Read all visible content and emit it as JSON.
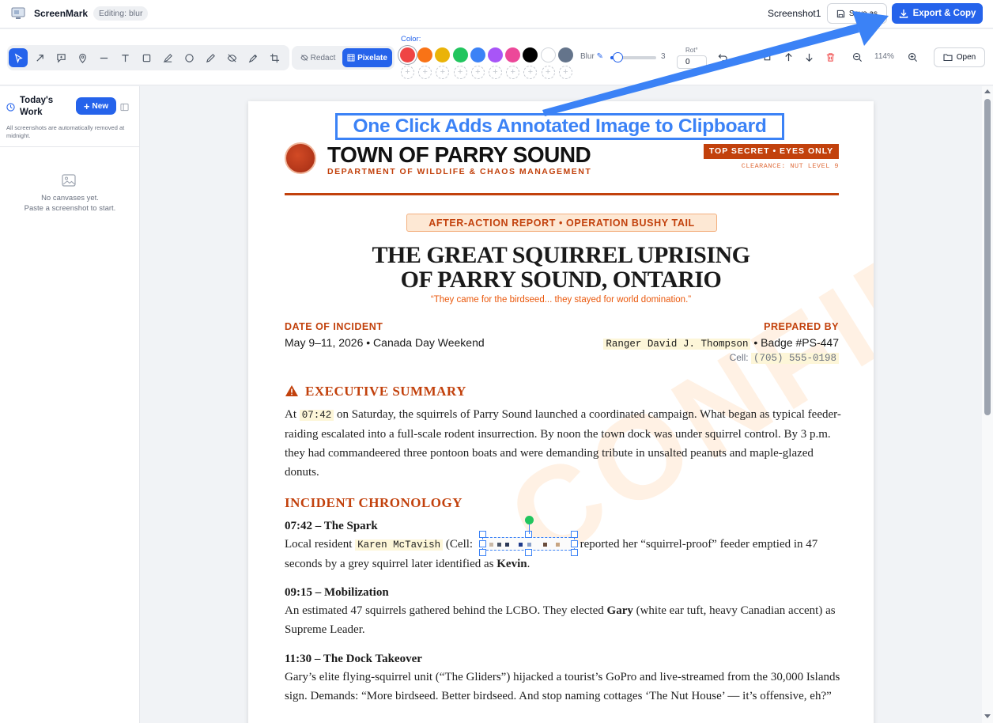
{
  "app": {
    "name": "ScreenMark",
    "editing_badge": "Editing: blur",
    "doc_title": "Screenshot1",
    "save_as": "Save as",
    "export_copy": "Export & Copy"
  },
  "toolbar": {
    "tools": [
      "select-icon",
      "arrow-icon",
      "callout-icon",
      "pin-icon",
      "line-icon",
      "text-icon",
      "rectangle-icon",
      "highlighter-icon",
      "circle-icon",
      "pen-icon",
      "hide-icon",
      "eyedropper-icon",
      "crop-icon"
    ],
    "redact": "Redact",
    "pixelate": "Pixelate",
    "color_label": "Color:",
    "colors": [
      "#ef4444",
      "#f97316",
      "#eab308",
      "#22c55e",
      "#3b82f6",
      "#a855f7",
      "#ec4899",
      "#000000",
      "#ffffff",
      "#64748b"
    ],
    "selected_color": "#ef4444",
    "blur_label": "Blur",
    "blur_value": "3",
    "blur_level": 0.1,
    "rot_label": "Rot°",
    "rot_value": "0",
    "zoom": "114%",
    "open": "Open"
  },
  "sidebar": {
    "title": "Today's Work",
    "new_button": "New",
    "note": "All screenshots are automatically removed at midnight.",
    "empty_line1": "No canvases yet.",
    "empty_line2": "Paste a screenshot to start."
  },
  "annotation": {
    "callout": "One Click Adds Annotated Image to Clipboard",
    "accent": "#3b82f6"
  },
  "document": {
    "town": "TOWN OF PARRY SOUND",
    "dept": "DEPARTMENT OF WILDLIFE & CHAOS MANAGEMENT",
    "secret": "TOP SECRET • EYES ONLY",
    "clearance": "CLEARANCE: NUT LEVEL 9",
    "banner": "AFTER-ACTION REPORT • OPERATION BUSHY TAIL",
    "title_line1": "THE GREAT SQUIRREL UPRISING",
    "title_line2": "OF PARRY SOUND, ONTARIO",
    "tagline": "“They came for the birdseed... they stayed for world domination.”",
    "date_label": "DATE OF INCIDENT",
    "date_value": "May 9–11, 2026 • Canada Day Weekend",
    "prepared_label": "PREPARED BY",
    "prepared_name": "Ranger David J. Thompson",
    "badge": " • Badge #PS-447",
    "cell_label": "Cell: ",
    "cell_value": "(705) 555-0198",
    "watermark": "CONFIDENTIAL",
    "exec_title": "EXECUTIVE SUMMARY",
    "exec_pre": "At ",
    "exec_time": "07:42",
    "exec_text": " on Saturday, the squirrels of Parry Sound launched a coordinated campaign. What began as typical feeder-raiding escalated into a full-scale rodent insurrection. By noon the town dock was under squirrel control. By 3 p.m. they had commandeered three pontoon boats and were demanding tribute in unsalted peanuts and maple-glazed donuts.",
    "chron_title": "INCIDENT CHRONOLOGY",
    "e1_title": "07:42 – The Spark",
    "e1_pre": "Local resident ",
    "e1_name": "Karen McTavish",
    "e1_cell": " (Cell: ",
    "e1_post": " reported her “squirrel-proof” feeder emptied in 47 seconds by a grey squirrel later identified as ",
    "e1_kevin": "Kevin",
    "e1_end": ".",
    "e2_title": "09:15 – Mobilization",
    "e2_pre": "An estimated 47 squirrels gathered behind the LCBO. They elected ",
    "e2_gary": "Gary",
    "e2_post": " (white ear tuft, heavy Canadian accent) as Supreme Leader.",
    "e3_title": "11:30 – The Dock Takeover",
    "e3_text": "Gary’s elite flying-squirrel unit (“The Gliders”) hijacked a tourist’s GoPro and live-streamed from the 30,000 Islands sign. Demands: “More birdseed. Better birdseed. And stop naming cottages ‘The Nut House’ — it’s offensive, eh?”"
  }
}
